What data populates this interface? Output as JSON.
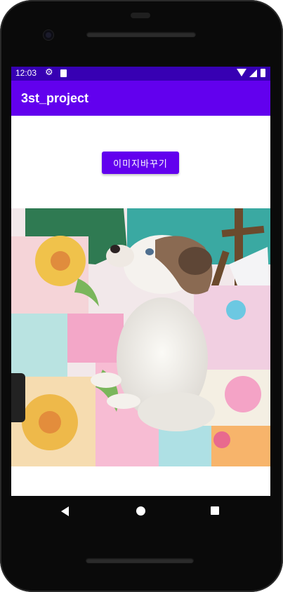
{
  "status_bar": {
    "time": "12:03",
    "icons": [
      "settings-icon",
      "sd-card-icon",
      "wifi-icon",
      "signal-icon",
      "battery-icon"
    ]
  },
  "app_bar": {
    "title": "3st_project",
    "color": "#6200EE"
  },
  "status_color": "#3700B3",
  "main": {
    "change_image_button": "이미지바꾸기"
  },
  "image": {
    "subject": "puppy sitting on a colorful quilt"
  },
  "nav": {
    "items": [
      "back-icon",
      "home-icon",
      "recents-icon"
    ]
  }
}
